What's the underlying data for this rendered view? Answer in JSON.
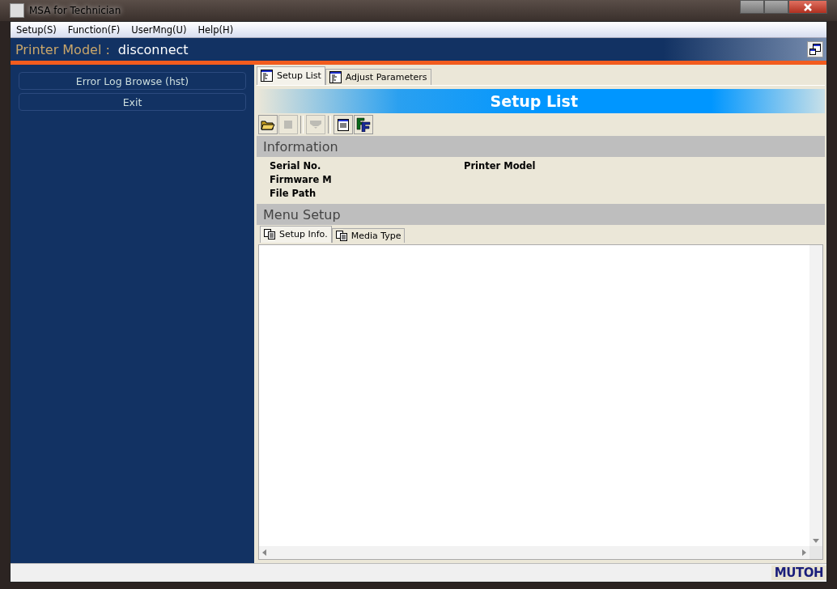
{
  "window": {
    "title": "MSA for Technician"
  },
  "menu_bar": [
    "Setup(S)",
    "Function(F)",
    "UserMng(U)",
    "Help(H)"
  ],
  "header": {
    "label": "Printer Model :",
    "value": "disconnect"
  },
  "sidebar": {
    "buttons": [
      "Error Log Browse (hst)",
      "Exit"
    ]
  },
  "tabs": [
    {
      "label": "Setup List",
      "selected": true
    },
    {
      "label": "Adjust Parameters",
      "selected": false
    }
  ],
  "banner": {
    "title": "Setup List"
  },
  "toolbar": [
    {
      "kind": "open",
      "disabled": false
    },
    {
      "kind": "stop",
      "disabled": true
    },
    {
      "kind": "down",
      "disabled": true
    },
    {
      "kind": "window",
      "disabled": false
    },
    {
      "kind": "ff",
      "disabled": false
    }
  ],
  "information": {
    "title": "Information",
    "fields": [
      {
        "label": "Serial No."
      },
      {
        "label": "Firmware M"
      },
      {
        "label": "File Path"
      },
      {
        "label": "Printer Model"
      }
    ]
  },
  "menu_setup": {
    "title": "Menu Setup",
    "tabs": [
      {
        "label": "Setup Info.",
        "selected": true
      },
      {
        "label": "Media Type",
        "selected": false
      }
    ]
  },
  "status_bar": {
    "logo": "MUTOH"
  }
}
